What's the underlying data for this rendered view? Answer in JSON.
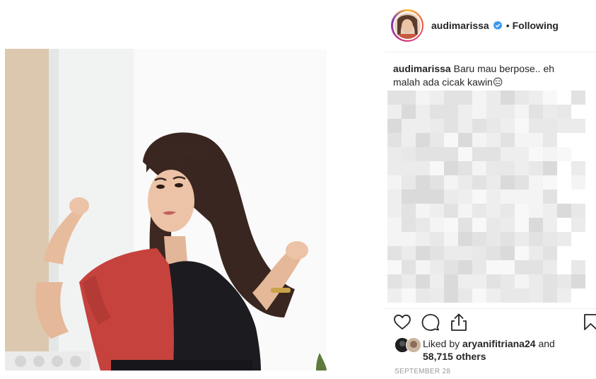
{
  "post": {
    "username": "audimarissa",
    "separator": "•",
    "follow_status": "Following",
    "verified": true,
    "caption_user": "audimarissa",
    "caption_text": "Baru mau berpose.. eh malah ada cicak kawin",
    "caption_emoji": "😑",
    "comments_obscured": true,
    "likes": {
      "prefix": "Liked by",
      "user": "aryanifitriana24",
      "middle": "and",
      "count": "58,715 others"
    },
    "date": "SEPTEMBER 28"
  },
  "icons": {
    "like": "heart-icon",
    "comment": "comment-icon",
    "share": "share-icon",
    "save": "bookmark-icon",
    "verified": "verified-badge-icon"
  },
  "colors": {
    "verified_blue": "#3897f0",
    "dress_red": "#c9453f",
    "dress_black": "#1b1b1f",
    "text_dark": "#262626",
    "text_muted": "#999999"
  }
}
